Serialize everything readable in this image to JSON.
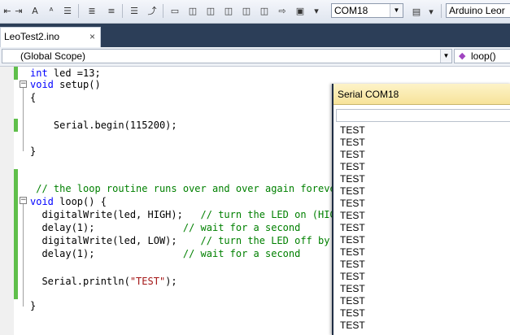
{
  "toolbar": {
    "buttons": [
      "outdent-icon",
      "indent-icon",
      "format-left-icon",
      "format-right-icon",
      "font-size-icon",
      "text-wrap-icon",
      "comment-icon",
      "uncomment-icon",
      "bookmark-icon",
      "bookmark-prev-icon",
      "bookmark-next-icon",
      "bookmark-clear-icon",
      "bookmark-folder-icon",
      "find-icon",
      "more-icon"
    ],
    "port_combo": "COM18",
    "board_combo": "Arduino Leor"
  },
  "tab": {
    "label": "LeoTest2.ino",
    "close": "×"
  },
  "scope": {
    "left": "(Global Scope)",
    "right": "loop()"
  },
  "code": [
    [
      "",
      [
        "int",
        "kw"
      ],
      [
        " led =13;",
        ""
      ]
    ],
    [
      "",
      [
        "void",
        "kw"
      ],
      [
        " setup()",
        ""
      ]
    ],
    [
      "",
      [
        "{",
        ""
      ]
    ],
    [
      "",
      [
        "",
        ""
      ]
    ],
    [
      "",
      [
        "    Serial.begin(115200);",
        ""
      ]
    ],
    [
      "",
      [
        "",
        ""
      ]
    ],
    [
      "",
      [
        "}",
        ""
      ]
    ],
    [
      "",
      [
        "",
        ""
      ]
    ],
    [
      "",
      [
        "",
        ""
      ]
    ],
    [
      "",
      [
        " // the loop routine runs over and over again forever",
        "cm"
      ]
    ],
    [
      "",
      [
        "void",
        "kw"
      ],
      [
        " loop() {",
        ""
      ]
    ],
    [
      "",
      [
        "  digitalWrite(led, HIGH);   ",
        ""
      ],
      [
        "// turn the LED on (HIGH",
        "cm"
      ]
    ],
    [
      "",
      [
        "  delay(1);               ",
        ""
      ],
      [
        "// wait for a second",
        "cm"
      ]
    ],
    [
      "",
      [
        "  digitalWrite(led, LOW);    ",
        ""
      ],
      [
        "// turn the LED off by m",
        "cm"
      ]
    ],
    [
      "",
      [
        "  delay(1);               ",
        ""
      ],
      [
        "// wait for a second",
        "cm"
      ]
    ],
    [
      "",
      [
        "",
        ""
      ]
    ],
    [
      "",
      [
        "  Serial.println(",
        ""
      ],
      [
        "\"TEST\"",
        "st"
      ],
      [
        ");",
        ""
      ]
    ],
    [
      "",
      [
        "",
        ""
      ]
    ],
    [
      "",
      [
        "}",
        ""
      ]
    ]
  ],
  "serial": {
    "title": "Serial COM18",
    "lines": [
      "TEST",
      "TEST",
      "TEST",
      "TEST",
      "TEST",
      "TEST",
      "TEST",
      "TEST",
      "TEST",
      "TEST",
      "TEST",
      "TEST",
      "TEST",
      "TEST",
      "TEST",
      "TEST",
      "TEST"
    ]
  },
  "colors": {
    "keyword": "#0000ff",
    "comment": "#008000",
    "string": "#a31515",
    "changebar": "#5fbf4a",
    "tabstrip": "#2c3e58"
  }
}
